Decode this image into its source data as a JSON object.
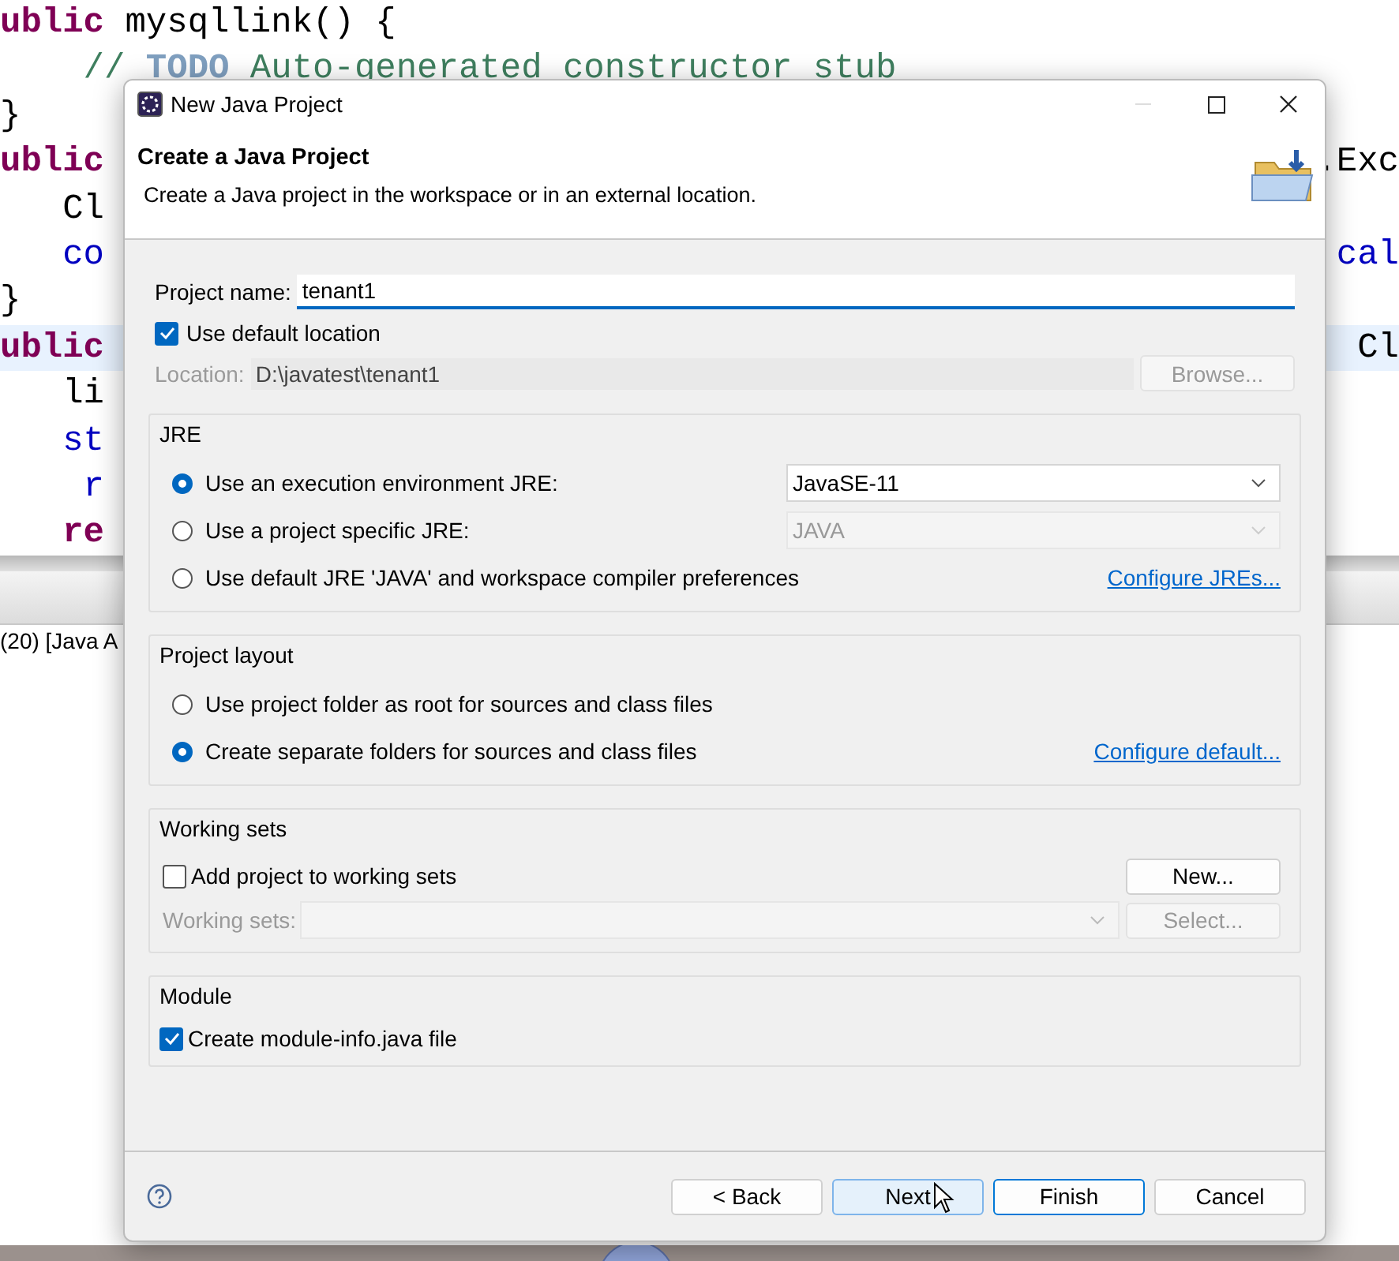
{
  "editor": {
    "lines": [
      {
        "left": [
          {
            "text": "ublic",
            "kind": "keyword"
          },
          {
            "text": " mysqllink() {",
            "kind": "plain"
          }
        ],
        "highlighted": false
      },
      {
        "left": [
          {
            "text": "    // ",
            "kind": "comment"
          },
          {
            "text": "TODO",
            "kind": "todo"
          },
          {
            "text": " Auto-generated constructor stub",
            "kind": "comment"
          }
        ],
        "highlighted": false
      },
      {
        "left": [
          {
            "text": "}",
            "kind": "plain"
          }
        ],
        "highlighted": false
      },
      {
        "left": [
          {
            "text": "ublic",
            "kind": "keyword"
          }
        ],
        "right": [
          {
            "text": ".Exc",
            "kind": "plain"
          }
        ],
        "highlighted": false
      },
      {
        "left": [
          {
            "text": "   Cl",
            "kind": "plain"
          }
        ],
        "highlighted": false
      },
      {
        "left": [
          {
            "text": "   co",
            "kind": "field"
          }
        ],
        "right": [
          {
            "text": "cal",
            "kind": "field"
          }
        ],
        "highlighted": false
      },
      {
        "left": [
          {
            "text": "}",
            "kind": "plain"
          }
        ],
        "highlighted": false
      },
      {
        "left": [
          {
            "text": "ublic",
            "kind": "keyword"
          }
        ],
        "right": [
          {
            "text": "Cl",
            "kind": "plain"
          }
        ],
        "highlighted": true
      },
      {
        "left": [
          {
            "text": "   li",
            "kind": "plain"
          }
        ],
        "highlighted": false
      },
      {
        "left": [
          {
            "text": "   st",
            "kind": "field"
          }
        ],
        "highlighted": false
      },
      {
        "left": [
          {
            "text": "    r",
            "kind": "field"
          }
        ],
        "highlighted": false
      },
      {
        "left": [
          {
            "text": "   re",
            "kind": "keyword"
          }
        ],
        "highlighted": false
      }
    ]
  },
  "console": {
    "tab_label": "(20) [Java A"
  },
  "dialog": {
    "title": "New Java Project",
    "heading": "Create a Java Project",
    "description": "Create a Java project in the workspace or in an external location.",
    "project_name": {
      "label": "Project name:",
      "value": "tenant1"
    },
    "use_default_location": {
      "label": "Use default location",
      "checked": true
    },
    "location": {
      "label": "Location:",
      "value": "D:\\javatest\\tenant1",
      "disabled": true
    },
    "browse_button": {
      "label": "Browse...",
      "disabled": true
    },
    "groups": [
      {
        "title": "JRE",
        "kind": "radios",
        "options": [
          {
            "label": "Use an execution environment JRE:",
            "selected": true,
            "select": {
              "value": "JavaSE-11",
              "disabled": false
            }
          },
          {
            "label": "Use a project specific JRE:",
            "selected": false,
            "select": {
              "value": "JAVA",
              "disabled": true
            }
          },
          {
            "label": "Use default JRE 'JAVA' and workspace compiler preferences",
            "selected": false,
            "link": "Configure JREs..."
          }
        ]
      },
      {
        "title": "Project layout",
        "kind": "radios",
        "options": [
          {
            "label": "Use project folder as root for sources and class files",
            "selected": false
          },
          {
            "label": "Create separate folders for sources and class files",
            "selected": true,
            "link": "Configure default..."
          }
        ]
      },
      {
        "title": "Working sets",
        "kind": "working_sets",
        "checkbox": {
          "label": "Add project to working sets",
          "checked": false
        },
        "new_button": "New...",
        "field": {
          "label": "Working sets:",
          "disabled": true
        },
        "select_button": {
          "label": "Select...",
          "disabled": true
        }
      },
      {
        "title": "Module",
        "kind": "checkbox",
        "checkbox": {
          "label": "Create module-info.java file",
          "checked": true
        }
      }
    ],
    "buttons": [
      {
        "label": "< Back",
        "kind": "normal"
      },
      {
        "label": "Next",
        "kind": "hover"
      },
      {
        "label": "Finish",
        "kind": "default"
      },
      {
        "label": "Cancel",
        "kind": "normal"
      }
    ]
  }
}
